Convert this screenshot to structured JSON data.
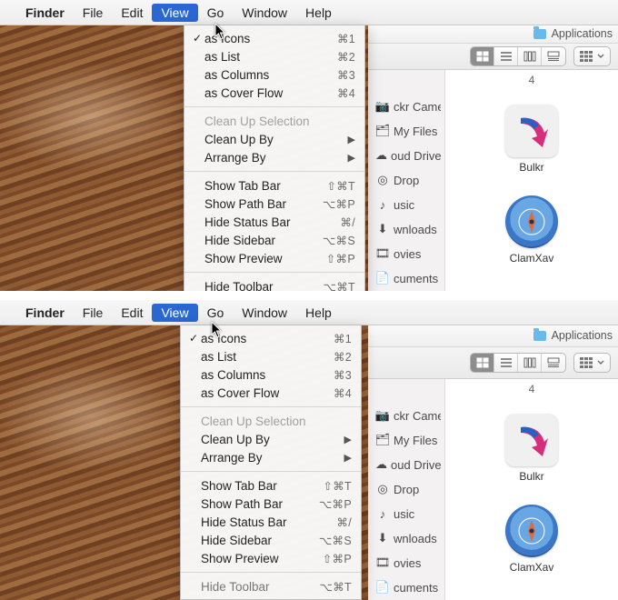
{
  "menubar": {
    "items": [
      "Finder",
      "File",
      "Edit",
      "View",
      "Go",
      "Window",
      "Help"
    ],
    "active_index": 3
  },
  "view_menu": {
    "sections": [
      [
        {
          "label": "as Icons",
          "shortcut": "⌘1",
          "checked": true
        },
        {
          "label": "as List",
          "shortcut": "⌘2",
          "checked": false
        },
        {
          "label": "as Columns",
          "shortcut": "⌘3",
          "checked": false
        },
        {
          "label": "as Cover Flow",
          "shortcut": "⌘4",
          "checked": false
        }
      ],
      [
        {
          "label": "Clean Up Selection",
          "disabled": true
        },
        {
          "label": "Clean Up By",
          "submenu": true
        },
        {
          "label": "Arrange By",
          "submenu": true
        }
      ],
      [
        {
          "label": "Show Tab Bar",
          "shortcut": "⇧⌘T"
        },
        {
          "label": "Show Path Bar",
          "shortcut": "⌥⌘P"
        },
        {
          "label": "Hide Status Bar",
          "shortcut": "⌘/"
        },
        {
          "label": "Hide Sidebar",
          "shortcut": "⌥⌘S"
        },
        {
          "label": "Show Preview",
          "shortcut": "⇧⌘P"
        }
      ],
      [
        {
          "label": "Hide Toolbar",
          "shortcut": "⌥⌘T"
        }
      ]
    ]
  },
  "finder": {
    "title": "Applications",
    "count_label": "4",
    "sidebar_items": [
      {
        "label": "ckr Camera…"
      },
      {
        "label": "My Files"
      },
      {
        "label": "oud Drive"
      },
      {
        "label": "Drop"
      },
      {
        "label": "usic"
      },
      {
        "label": "wnloads"
      },
      {
        "label": "ovies"
      },
      {
        "label": "cuments"
      }
    ],
    "apps": [
      {
        "name": "Bulkr"
      },
      {
        "name": "ClamXav"
      }
    ],
    "view_modes": [
      "icon-view",
      "list-view",
      "column-view",
      "coverflow-view"
    ],
    "active_view_mode_index": 0
  }
}
